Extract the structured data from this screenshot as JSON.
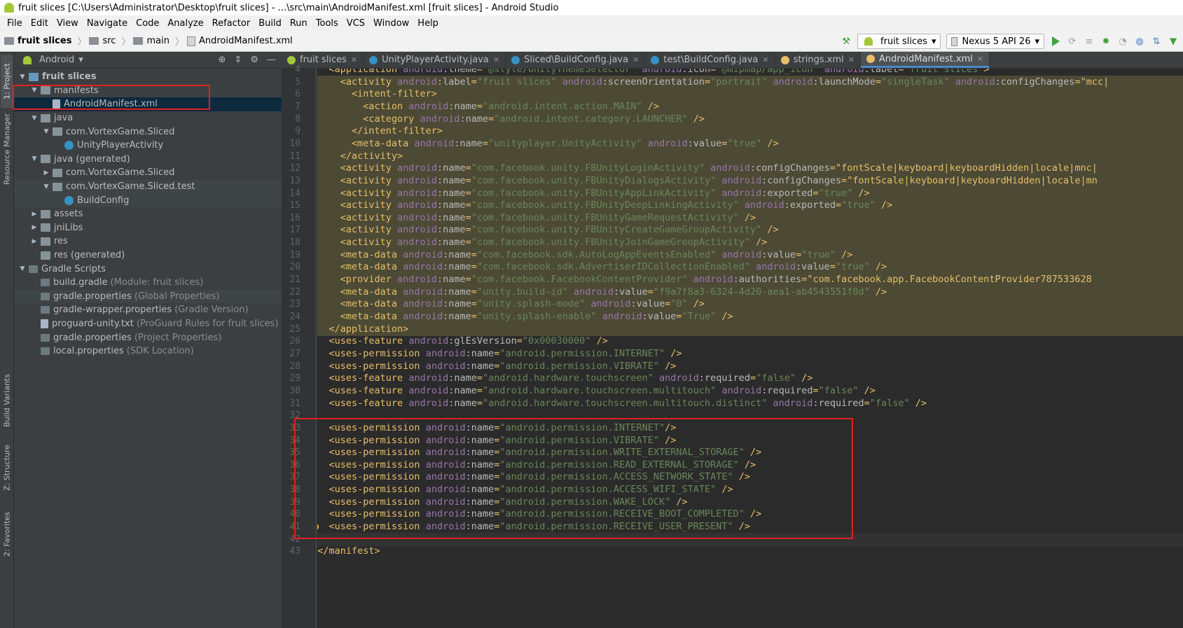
{
  "window": {
    "title": "fruit slices [C:\\Users\\Administrator\\Desktop\\fruit slices] - ...\\src\\main\\AndroidManifest.xml [fruit slices] - Android Studio"
  },
  "menu": [
    "File",
    "Edit",
    "View",
    "Navigate",
    "Code",
    "Analyze",
    "Refactor",
    "Build",
    "Run",
    "Tools",
    "VCS",
    "Window",
    "Help"
  ],
  "breadcrumb": [
    "fruit slices",
    "src",
    "main",
    "AndroidManifest.xml"
  ],
  "toolbar": {
    "run_config": "fruit slices",
    "device": "Nexus 5 API 26"
  },
  "side_tabs": {
    "project": "1: Project",
    "resource": "Resource Manager",
    "variants": "Build Variants",
    "structure": "Z: Structure",
    "favorites": "2: Favorites"
  },
  "project": {
    "view": "Android",
    "tree": [
      {
        "label": "fruit slices",
        "note": "",
        "depth": 0,
        "arrow": "down",
        "icon": "foldblue",
        "bold": true
      },
      {
        "label": "manifests",
        "note": "",
        "depth": 1,
        "arrow": "down",
        "icon": "fold"
      },
      {
        "label": "AndroidManifest.xml",
        "note": "",
        "depth": 2,
        "arrow": "",
        "icon": "file",
        "selected": true
      },
      {
        "label": "java",
        "note": "",
        "depth": 1,
        "arrow": "down",
        "icon": "fold"
      },
      {
        "label": "com.VortexGame.Sliced",
        "note": "",
        "depth": 2,
        "arrow": "down",
        "icon": "fold"
      },
      {
        "label": "UnityPlayerActivity",
        "note": "",
        "depth": 3,
        "arrow": "",
        "icon": "cls"
      },
      {
        "label": "java (generated)",
        "note": "",
        "depth": 1,
        "arrow": "down",
        "icon": "fold"
      },
      {
        "label": "com.VortexGame.Sliced",
        "note": "",
        "depth": 2,
        "arrow": "right",
        "icon": "fold"
      },
      {
        "label": "com.VortexGame.Sliced.test",
        "note": "",
        "depth": 2,
        "arrow": "down",
        "icon": "fold",
        "hl": true
      },
      {
        "label": "BuildConfig",
        "note": "",
        "depth": 3,
        "arrow": "",
        "icon": "cls",
        "hl": true
      },
      {
        "label": "assets",
        "note": "",
        "depth": 1,
        "arrow": "right",
        "icon": "fold"
      },
      {
        "label": "jniLibs",
        "note": "",
        "depth": 1,
        "arrow": "right",
        "icon": "fold"
      },
      {
        "label": "res",
        "note": "",
        "depth": 1,
        "arrow": "right",
        "icon": "fold"
      },
      {
        "label": "res (generated)",
        "note": "",
        "depth": 1,
        "arrow": "",
        "icon": "fold"
      },
      {
        "label": "Gradle Scripts",
        "note": "",
        "depth": 0,
        "arrow": "down",
        "icon": "gradle"
      },
      {
        "label": "build.gradle",
        "note": "(Module: fruit slices)",
        "depth": 1,
        "arrow": "",
        "icon": "gradle"
      },
      {
        "label": "gradle.properties",
        "note": "(Global Properties)",
        "depth": 1,
        "arrow": "",
        "icon": "gradle",
        "hl": true
      },
      {
        "label": "gradle-wrapper.properties",
        "note": "(Gradle Version)",
        "depth": 1,
        "arrow": "",
        "icon": "gradle"
      },
      {
        "label": "proguard-unity.txt",
        "note": "(ProGuard Rules for fruit slices)",
        "depth": 1,
        "arrow": "",
        "icon": "file"
      },
      {
        "label": "gradle.properties",
        "note": "(Project Properties)",
        "depth": 1,
        "arrow": "",
        "icon": "gradle"
      },
      {
        "label": "local.properties",
        "note": "(SDK Location)",
        "depth": 1,
        "arrow": "",
        "icon": "gradle"
      }
    ]
  },
  "tabs": [
    {
      "label": "fruit slices",
      "color": "#a4c639"
    },
    {
      "label": "UnityPlayerActivity.java",
      "color": "#3592c4"
    },
    {
      "label": "Sliced\\BuildConfig.java",
      "color": "#3592c4"
    },
    {
      "label": "test\\BuildConfig.java",
      "color": "#3592c4"
    },
    {
      "label": "strings.xml",
      "color": "#e8bf6a"
    },
    {
      "label": "AndroidManifest.xml",
      "color": "#e8bf6a",
      "active": true
    }
  ],
  "code": {
    "first_line": 4,
    "lines": [
      "    <application android:theme=\"@style/UnityThemeSelector\" android:icon=\"@mipmap/app_icon\" android:label=\"fruit slices\">",
      "      <activity android:label=\"fruit slices\" android:screenOrientation=\"portrait\" android:launchMode=\"singleTask\" android:configChanges=\"mcc|",
      "        <intent-filter>",
      "          <action android:name=\"android.intent.action.MAIN\" />",
      "          <category android:name=\"android.intent.category.LAUNCHER\" />",
      "        </intent-filter>",
      "        <meta-data android:name=\"unityplayer.UnityActivity\" android:value=\"true\" />",
      "      </activity>",
      "      <activity android:name=\"com.facebook.unity.FBUnityLoginActivity\" android:configChanges=\"fontScale|keyboard|keyboardHidden|locale|mnc|",
      "      <activity android:name=\"com.facebook.unity.FBUnityDialogsActivity\" android:configChanges=\"fontScale|keyboard|keyboardHidden|locale|mn",
      "      <activity android:name=\"com.facebook.unity.FBUnityAppLinkActivity\" android:exported=\"true\" />",
      "      <activity android:name=\"com.facebook.unity.FBUnityDeepLinkingActivity\" android:exported=\"true\" />",
      "      <activity android:name=\"com.facebook.unity.FBUnityGameRequestActivity\" />",
      "      <activity android:name=\"com.facebook.unity.FBUnityCreateGameGroupActivity\" />",
      "      <activity android:name=\"com.facebook.unity.FBUnityJoinGameGroupActivity\" />",
      "      <meta-data android:name=\"com.facebook.sdk.AutoLogAppEventsEnabled\" android:value=\"true\" />",
      "      <meta-data android:name=\"com.facebook.sdk.AdvertiserIDCollectionEnabled\" android:value=\"true\" />",
      "      <provider android:name=\"com.facebook.FacebookContentProvider\" android:authorities=\"com.facebook.app.FacebookContentProvider787533628",
      "      <meta-data android:name=\"unity.build-id\" android:value=\"f9a7f8a3-6324-4d20-aea1-ab4543551f8d\" />",
      "      <meta-data android:name=\"unity.splash-mode\" android:value=\"0\" />",
      "      <meta-data android:name=\"unity.splash-enable\" android:value=\"True\" />",
      "    </application>",
      "    <uses-feature android:glEsVersion=\"0x00030000\" />",
      "    <uses-permission android:name=\"android.permission.INTERNET\" />",
      "    <uses-permission android:name=\"android.permission.VIBRATE\" />",
      "    <uses-feature android:name=\"android.hardware.touchscreen\" android:required=\"false\" />",
      "    <uses-feature android:name=\"android.hardware.touchscreen.multitouch\" android:required=\"false\" />",
      "    <uses-feature android:name=\"android.hardware.touchscreen.multitouch.distinct\" android:required=\"false\" />",
      "",
      "    <uses-permission android:name=\"android.permission.INTERNET\"/>",
      "    <uses-permission android:name=\"android.permission.VIBRATE\" />",
      "    <uses-permission android:name=\"android.permission.WRITE_EXTERNAL_STORAGE\" />",
      "    <uses-permission android:name=\"android.permission.READ_EXTERNAL_STORAGE\" />",
      "    <uses-permission android:name=\"android.permission.ACCESS_NETWORK_STATE\" />",
      "    <uses-permission android:name=\"android.permission.ACCESS_WIFI_STATE\" />",
      "    <uses-permission android:name=\"android.permission.WAKE_LOCK\" />",
      "    <uses-permission android:name=\"android.permission.RECEIVE_BOOT_COMPLETED\" />",
      "    <uses-permission android:name=\"android.permission.RECEIVE_USER_PRESENT\" />",
      "",
      "  </manifest>"
    ]
  },
  "colors": {
    "accent": "#4a88c7",
    "annotation": "#e02020",
    "highlight_block": "#4c4a35"
  }
}
